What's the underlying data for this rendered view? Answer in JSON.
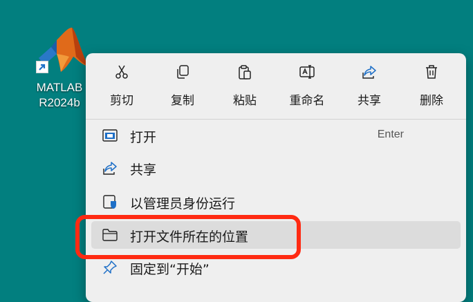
{
  "desktop": {
    "icon_name": "matlab-icon",
    "label_line1": "MATLAB",
    "label_line2": "R2024b"
  },
  "context_menu": {
    "actions": [
      {
        "label": "剪切",
        "icon": "scissors-icon"
      },
      {
        "label": "复制",
        "icon": "copy-icon"
      },
      {
        "label": "粘贴",
        "icon": "paste-icon"
      },
      {
        "label": "重命名",
        "icon": "rename-icon"
      },
      {
        "label": "共享",
        "icon": "share-icon"
      },
      {
        "label": "删除",
        "icon": "trash-icon"
      }
    ],
    "items": [
      {
        "label": "打开",
        "shortcut": "Enter",
        "icon": "open-window-icon"
      },
      {
        "label": "共享",
        "icon": "share-icon"
      },
      {
        "label": "以管理员身份运行",
        "icon": "shield-icon"
      },
      {
        "label": "打开文件所在的位置",
        "icon": "folder-icon",
        "hovered": true
      },
      {
        "label": "固定到“开始”",
        "icon": "pin-icon"
      }
    ]
  },
  "colors": {
    "desktop_background": "#027f7f",
    "menu_background": "#efefef",
    "highlight_border": "#ff2a12"
  }
}
